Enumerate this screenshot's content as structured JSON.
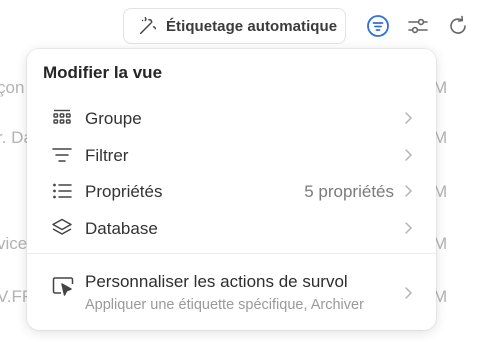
{
  "toolbar": {
    "auto_label_button": "Étiquetage automatique",
    "accent_color": "#2f6fd6"
  },
  "background": {
    "left_fragments": [
      "çon",
      "r. Da",
      "vice",
      "V.FF"
    ],
    "right_fragments": [
      "M",
      "M",
      "M",
      "M",
      "M"
    ]
  },
  "popover": {
    "title": "Modifier la vue",
    "items": [
      {
        "label": "Groupe",
        "value": ""
      },
      {
        "label": "Filtrer",
        "value": ""
      },
      {
        "label": "Propriétés",
        "value": "5 propriétés"
      },
      {
        "label": "Database",
        "value": ""
      }
    ],
    "hover_actions": {
      "title": "Personnaliser les actions de survol",
      "subtitle": "Appliquer une étiquette spécifique, Archiver"
    }
  }
}
